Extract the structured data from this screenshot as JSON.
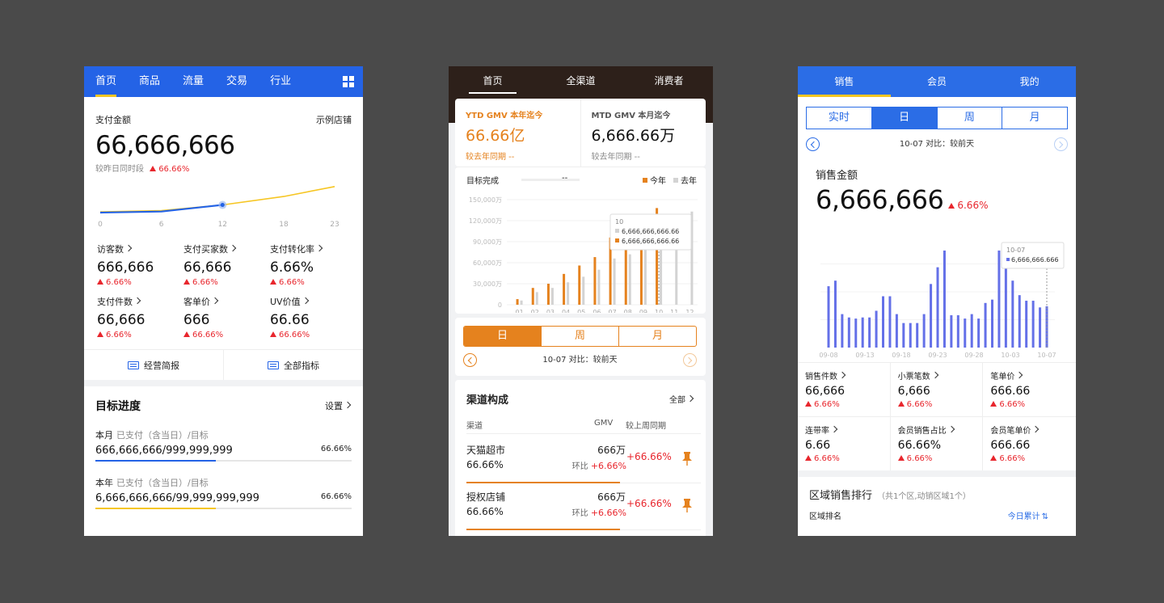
{
  "p1": {
    "tabs": [
      "首页",
      "商品",
      "流量",
      "交易",
      "行业"
    ],
    "pay_label": "支付金额",
    "shop_label": "示例店铺",
    "pay_value": "66,666,666",
    "cmp_label": "较昨日同时段",
    "cmp_value": "66.66%",
    "xticks": [
      "0",
      "6",
      "12",
      "18",
      "23"
    ],
    "metrics": [
      {
        "label": "访客数",
        "value": "666,666",
        "delta": "6.66%"
      },
      {
        "label": "支付买家数",
        "value": "66,666",
        "delta": "6.66%"
      },
      {
        "label": "支付转化率",
        "value": "6.66%",
        "delta": "6.66%"
      },
      {
        "label": "支付件数",
        "value": "66,666",
        "delta": "6.66%"
      },
      {
        "label": "客单价",
        "value": "666",
        "delta": "66.66%"
      },
      {
        "label": "UV价值",
        "value": "66.66",
        "delta": "66.66%"
      }
    ],
    "btn_report": "经营简报",
    "btn_all": "全部指标",
    "goal_title": "目标进度",
    "goal_set": "设置",
    "goals": [
      {
        "period": "本月",
        "desc": "已支付（含当日）/目标",
        "value": "666,666,666/999,999,999",
        "pct": "66.66%",
        "progress": 0.47,
        "color": "#2463e6"
      },
      {
        "period": "本年",
        "desc": "已支付（含当日）/目标",
        "value": "6,666,666,666/99,999,999,999",
        "pct": "66.66%",
        "progress": 0.47,
        "color": "#f6c623"
      }
    ],
    "colors": {
      "blue": "#2463e6",
      "yellow": "#f6c623"
    }
  },
  "p2": {
    "tabs": [
      "首页",
      "全渠道",
      "消费者"
    ],
    "ytd_title": "YTD GMV 本年迄今",
    "ytd_value": "66.66亿",
    "ytd_cmp": "较去年同期 --",
    "mtd_title": "MTD GMV 本月迄今",
    "mtd_value": "6,666.66万",
    "mtd_cmp": "较去年同期 --",
    "target_label": "目标完成",
    "target_value": "--",
    "legend_this": "今年",
    "legend_last": "去年",
    "tooltip_title": "10",
    "tooltip_last": "6,666,666,666.66",
    "tooltip_this": "6,666,666,666.66",
    "seg": [
      "日",
      "周",
      "月"
    ],
    "date_text": "10-07 对比：较前天",
    "channel_title": "渠道构成",
    "channel_all": "全部",
    "hdr_channel": "渠道",
    "hdr_gmv": "GMV",
    "hdr_wow": "较上周同期",
    "rows": [
      {
        "name": "天猫超市",
        "pct": "66.66%",
        "gmv": "666万",
        "hb_label": "环比",
        "hb": "+6.66%",
        "wow": "+66.66%"
      },
      {
        "name": "授权店铺",
        "pct": "66.66%",
        "gmv": "666万",
        "hb_label": "环比",
        "hb": "+6.66%",
        "wow": "+66.66%"
      }
    ],
    "colors": {
      "orange": "#e5821e",
      "gray": "#d3d3d3"
    }
  },
  "p3": {
    "tabs": [
      "销售",
      "会员",
      "我的"
    ],
    "seg": [
      "实时",
      "日",
      "周",
      "月"
    ],
    "date_text": "10-07 对比：较前天",
    "sales_label": "销售金额",
    "sales_value": "6,666,666",
    "sales_delta": "6.66%",
    "tooltip_date": "10-07",
    "tooltip_value": "6,666,666.666",
    "metrics": [
      {
        "label": "销售件数",
        "value": "66,666",
        "delta": "6.66%"
      },
      {
        "label": "小票笔数",
        "value": "6,666",
        "delta": "6.66%"
      },
      {
        "label": "笔单价",
        "value": "666.66",
        "delta": "6.66%"
      },
      {
        "label": "连带率",
        "value": "6.66",
        "delta": "6.66%"
      },
      {
        "label": "会员销售占比",
        "value": "66.66%",
        "delta": "6.66%"
      },
      {
        "label": "会员笔单价",
        "value": "666.66",
        "delta": "6.66%"
      }
    ],
    "rank_title": "区域销售排行",
    "rank_sub": "（共1个区,动销区域1个）",
    "rank_col": "区域排名",
    "rank_right": "今日累计",
    "colors": {
      "blue": "#2b6de6",
      "bar": "#6470e8"
    }
  },
  "chart_data": [
    {
      "type": "line",
      "x": [
        0,
        6,
        12,
        18,
        23
      ],
      "xlim": [
        0,
        23
      ],
      "series": [
        {
          "values": [
            0.1,
            0.18,
            0.55,
            1.1,
            1.75
          ],
          "color": "#f6c623"
        },
        {
          "values": [
            0.05,
            0.12,
            0.55,
            null,
            null
          ],
          "color": "#2463e6"
        }
      ]
    },
    {
      "type": "bar",
      "categories": [
        "01",
        "02",
        "03",
        "04",
        "05",
        "06",
        "07",
        "08",
        "09",
        "10",
        "11",
        "12"
      ],
      "yticks": [
        "150,000万",
        "120,000万",
        "90,000万",
        "60,000万",
        "30,000万",
        "0"
      ],
      "ylim": [
        0,
        150000
      ],
      "series": [
        {
          "name": "今年",
          "values": [
            8000,
            24000,
            30000,
            44000,
            56000,
            68000,
            96000,
            117000,
            126000,
            138000,
            null,
            null
          ],
          "color": "#e5821e"
        },
        {
          "name": "去年",
          "values": [
            6000,
            18000,
            24000,
            32000,
            40000,
            50000,
            66000,
            72000,
            112000,
            126000,
            128000,
            133000
          ],
          "color": "#d3d3d3"
        }
      ]
    },
    {
      "type": "bar",
      "xticks": [
        "09-08",
        "09-13",
        "09-18",
        "09-23",
        "09-28",
        "10-03",
        "10-07"
      ],
      "values": [
        0.55,
        0.6,
        0.3,
        0.27,
        0.26,
        0.27,
        0.27,
        0.33,
        0.46,
        0.46,
        0.3,
        0.22,
        0.22,
        0.22,
        0.3,
        0.57,
        0.72,
        0.87,
        0.29,
        0.29,
        0.26,
        0.3,
        0.26,
        0.4,
        0.43,
        0.87,
        0.82,
        0.6,
        0.47,
        0.42,
        0.42,
        0.36,
        0.37
      ]
    }
  ]
}
